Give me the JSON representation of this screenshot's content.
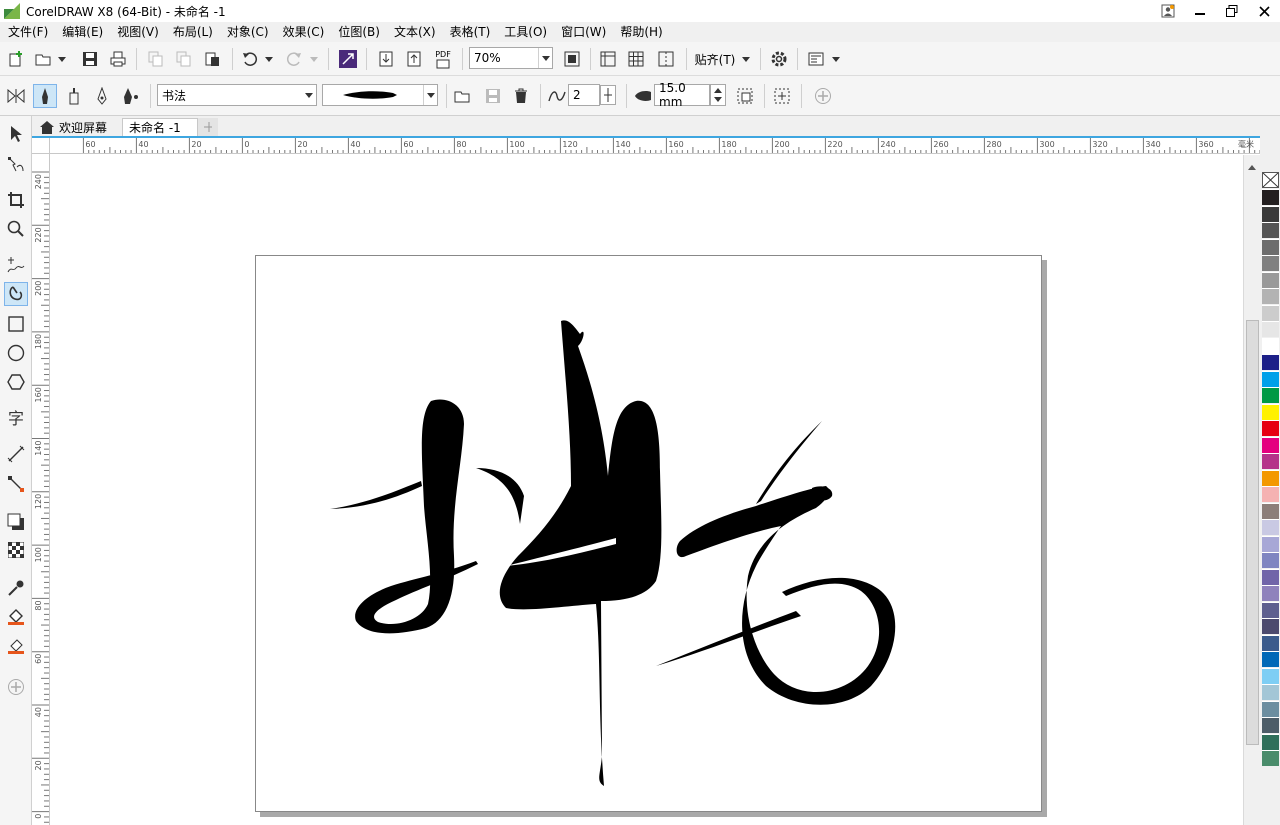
{
  "titlebar": {
    "title": "CorelDRAW X8 (64-Bit) - 未命名 -1"
  },
  "menu": [
    "文件(F)",
    "编辑(E)",
    "视图(V)",
    "布局(L)",
    "对象(C)",
    "效果(C)",
    "位图(B)",
    "文本(X)",
    "表格(T)",
    "工具(O)",
    "窗口(W)",
    "帮助(H)"
  ],
  "toolbar": {
    "zoom_value": "70%",
    "snap_label": "贴齐(T)",
    "pdf_label": "PDF"
  },
  "propertybar": {
    "preset_value": "书法",
    "smoothing_value": "2",
    "width_value": "15.0 mm"
  },
  "tabs": {
    "welcome_label": "欢迎屏幕",
    "doc_label": "未命名 -1"
  },
  "ruler": {
    "h_labels": [
      "60",
      "40",
      "20",
      "0",
      "20",
      "40",
      "60",
      "80",
      "100",
      "120",
      "140",
      "160",
      "180",
      "200",
      "220",
      "240",
      "260",
      "280",
      "300",
      "320",
      "340",
      "360"
    ],
    "v_labels": [
      "240",
      "220",
      "200",
      "180",
      "160",
      "140",
      "120",
      "100",
      "80",
      "60",
      "40",
      "20",
      "0"
    ],
    "unit_h": "毫米",
    "unit_v": "毫米"
  },
  "palette": {
    "colors": [
      "#231f20",
      "#3a3a3a",
      "#555555",
      "#6d6d6d",
      "#808080",
      "#999999",
      "#b3b3b3",
      "#cccccc",
      "#e6e6e6",
      "#ffffff",
      "#1d2088",
      "#00a0e9",
      "#009944",
      "#fff100",
      "#e60012",
      "#e4007f",
      "#b5338a",
      "#f39800",
      "#f5b2b2",
      "#8c7e79",
      "#c9c9e3",
      "#a7a7d6",
      "#7f85c1",
      "#7165a9",
      "#8f82bc",
      "#5e5f8f",
      "#4c4a6e",
      "#3b5b8c",
      "#0068b7",
      "#7ecef4",
      "#a3c6d6",
      "#6c8ea0",
      "#4d5d68",
      "#2f6f5a",
      "#4a8c6b"
    ]
  }
}
